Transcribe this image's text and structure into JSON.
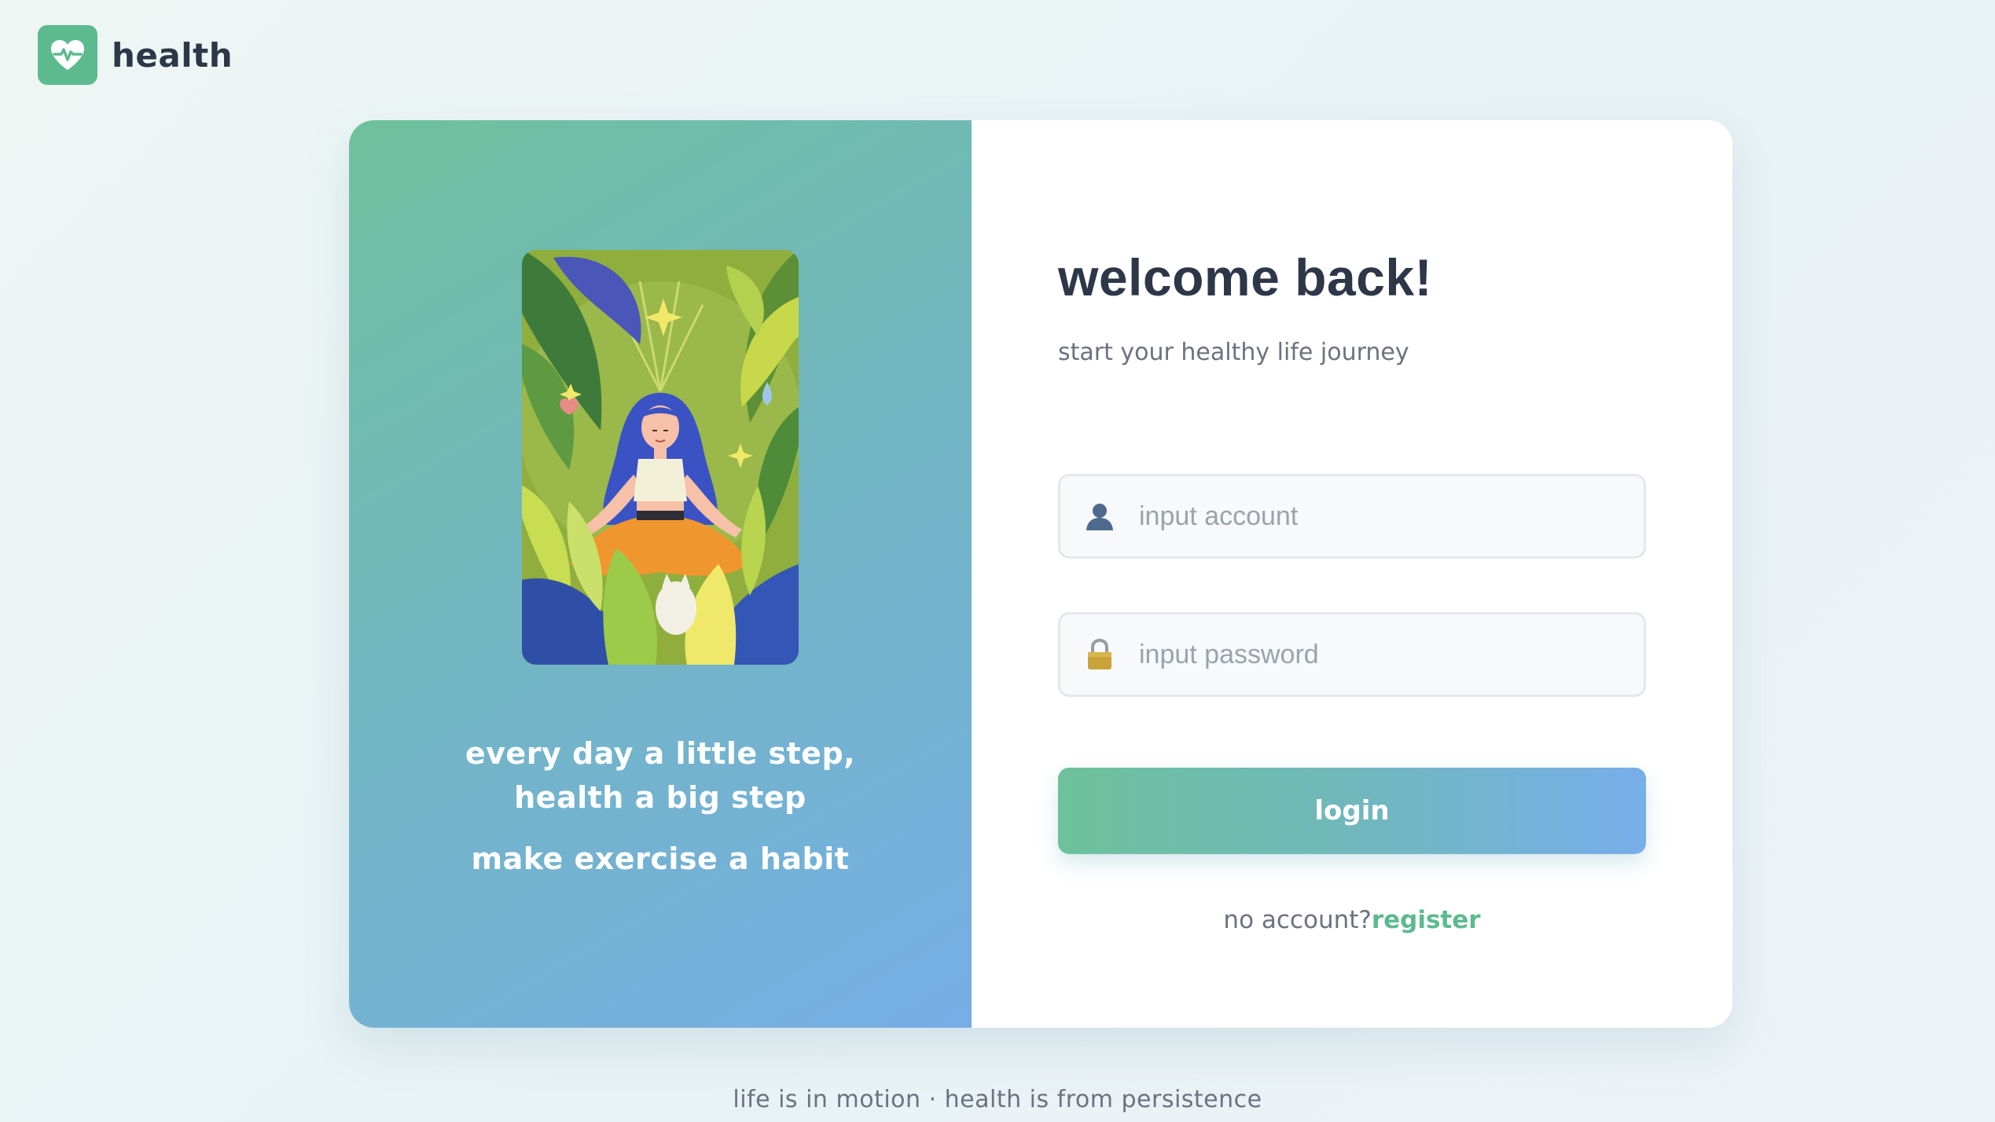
{
  "brand": {
    "name": "health",
    "icon": "heart-pulse-icon",
    "color": "#5dba8f"
  },
  "showcase": {
    "illustration": "meditating-woman-jungle-illustration",
    "slogan_line1": "every day a little step, health a big step",
    "slogan_line2": "make exercise a habit",
    "gradient": [
      "#6fc19d",
      "#76aee6"
    ]
  },
  "login_form": {
    "title": "welcome back!",
    "subtitle": "start your healthy life journey",
    "account": {
      "icon": "user-icon",
      "placeholder": "input account",
      "value": ""
    },
    "password": {
      "icon": "lock-icon",
      "placeholder": "input password",
      "value": ""
    },
    "login_label": "login",
    "register_prompt": "no account?",
    "register_label": "register"
  },
  "footer": {
    "tagline": "life is in motion · health is from persistence"
  }
}
